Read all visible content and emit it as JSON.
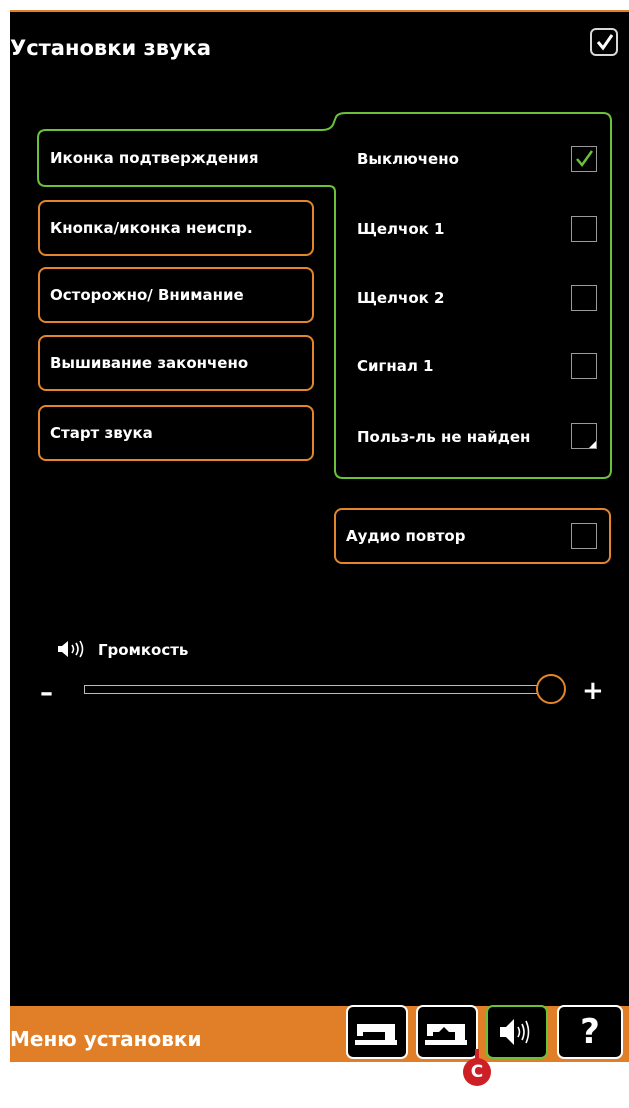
{
  "header": {
    "title": "Установки звука",
    "confirm_icon": "check-icon"
  },
  "categories": [
    {
      "label": "Иконка подтверждения",
      "active": true
    },
    {
      "label": "Кнопка/иконка неиспр.",
      "active": false
    },
    {
      "label": "Осторожно/ Внимание",
      "active": false
    },
    {
      "label": "Вышивание закончено",
      "active": false
    },
    {
      "label": "Старт звука",
      "active": false
    }
  ],
  "sound_options": [
    {
      "label": "Выключено",
      "checked": true
    },
    {
      "label": "Щелчок 1",
      "checked": false
    },
    {
      "label": "Щелчок 2",
      "checked": false
    },
    {
      "label": "Сигнал 1",
      "checked": false
    },
    {
      "label": "Польз-ль не найден",
      "checked": false
    }
  ],
  "audio_repeat": {
    "label": "Аудио повтор",
    "checked": false
  },
  "volume": {
    "label": "Громкость",
    "minus": "–",
    "plus": "+",
    "level": 1.0
  },
  "footer": {
    "title": "Меню установки",
    "buttons": [
      {
        "name": "sewing-machine-settings-button",
        "icon": "sewing-machine-icon",
        "active": false
      },
      {
        "name": "embroidery-settings-button",
        "icon": "embroidery-machine-icon",
        "active": false
      },
      {
        "name": "sound-settings-button",
        "icon": "speaker-icon",
        "active": true
      },
      {
        "name": "help-button",
        "icon": "question-mark-icon",
        "label": "?",
        "active": false
      }
    ]
  },
  "annotation": {
    "marker": "C"
  },
  "colors": {
    "accent_orange": "#e3852b",
    "active_green": "#6bc13a",
    "background": "#000000",
    "marker_red": "#cc1f26"
  }
}
